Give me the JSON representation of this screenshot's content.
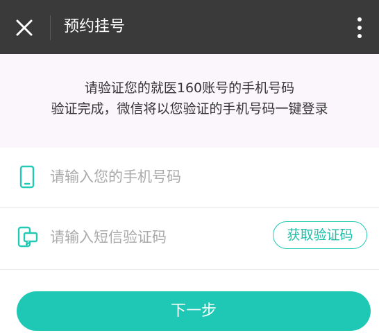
{
  "header": {
    "title": "预约挂号",
    "close_icon": "close-icon",
    "more_icon": "more-vertical-icon"
  },
  "info": {
    "line1": "请验证您的就医160账号的手机号码",
    "line2": "验证完成，微信将以您验证的手机号码一键登录"
  },
  "phone": {
    "icon": "mobile-phone-icon",
    "value": "",
    "placeholder": "请输入您的手机号码"
  },
  "sms": {
    "icon": "sms-code-icon",
    "value": "",
    "placeholder": "请输入短信验证码",
    "get_code_label": "获取验证码"
  },
  "next_button": {
    "label": "下一步"
  },
  "colors": {
    "accent": "#1fc8b5",
    "header_bg": "#3a3a3a",
    "info_bg": "#fbf6fb"
  }
}
